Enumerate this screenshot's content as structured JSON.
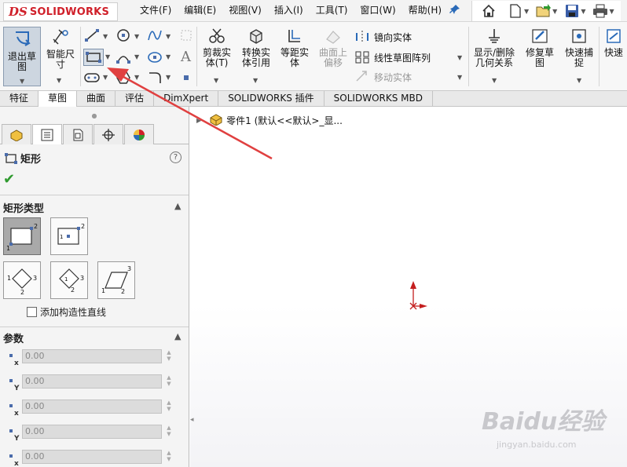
{
  "app": {
    "logo_ds": "DS",
    "logo_name": "SOLIDWORKS"
  },
  "menu": [
    {
      "label": "文件(F)"
    },
    {
      "label": "编辑(E)"
    },
    {
      "label": "视图(V)"
    },
    {
      "label": "插入(I)"
    },
    {
      "label": "工具(T)"
    },
    {
      "label": "窗口(W)"
    },
    {
      "label": "帮助(H)"
    }
  ],
  "quick_icons": [
    "home-icon",
    "new-document-icon",
    "open-folder-icon",
    "save-icon",
    "print-icon"
  ],
  "ribbon": {
    "exit_sketch": "退出草图",
    "smart_dim": "智能尺寸",
    "trim": "剪裁实体(T)",
    "convert": "转换实体引用",
    "offset": "等距实体",
    "surface_offset": "曲面上偏移",
    "mirror": "镜向实体",
    "linear_pattern": "线性草图阵列",
    "move": "移动实体",
    "show_relations": "显示/删除几何关系",
    "repair": "修复草图",
    "quick_snap": "快速捕捉",
    "rapid": "快速"
  },
  "tabs": [
    {
      "label": "特征",
      "active": false
    },
    {
      "label": "草图",
      "active": true
    },
    {
      "label": "曲面",
      "active": false
    },
    {
      "label": "评估",
      "active": false
    },
    {
      "label": "DimXpert",
      "active": false
    },
    {
      "label": "SOLIDWORKS 插件",
      "active": false
    },
    {
      "label": "SOLIDWORKS MBD",
      "active": false
    }
  ],
  "property_manager": {
    "title": "矩形",
    "help": "?",
    "ok": "✔",
    "group_rect_type": "矩形类型",
    "add_construction": "添加构造性直线",
    "group_params": "参数",
    "params": [
      {
        "axis": "x",
        "value": "0.00"
      },
      {
        "axis": "Y",
        "value": "0.00"
      },
      {
        "axis": "x",
        "value": "0.00"
      },
      {
        "axis": "Y",
        "value": "0.00"
      },
      {
        "axis": "x",
        "value": "0.00"
      }
    ]
  },
  "tree": {
    "part": "零件1 (默认<<默认>_显..."
  },
  "watermark": {
    "brand": "Baidu经验",
    "url": "jingyan.baidu.com"
  },
  "colors": {
    "accent": "#d0202a",
    "arrow": "#e04040",
    "ok": "#2f9a2f"
  }
}
